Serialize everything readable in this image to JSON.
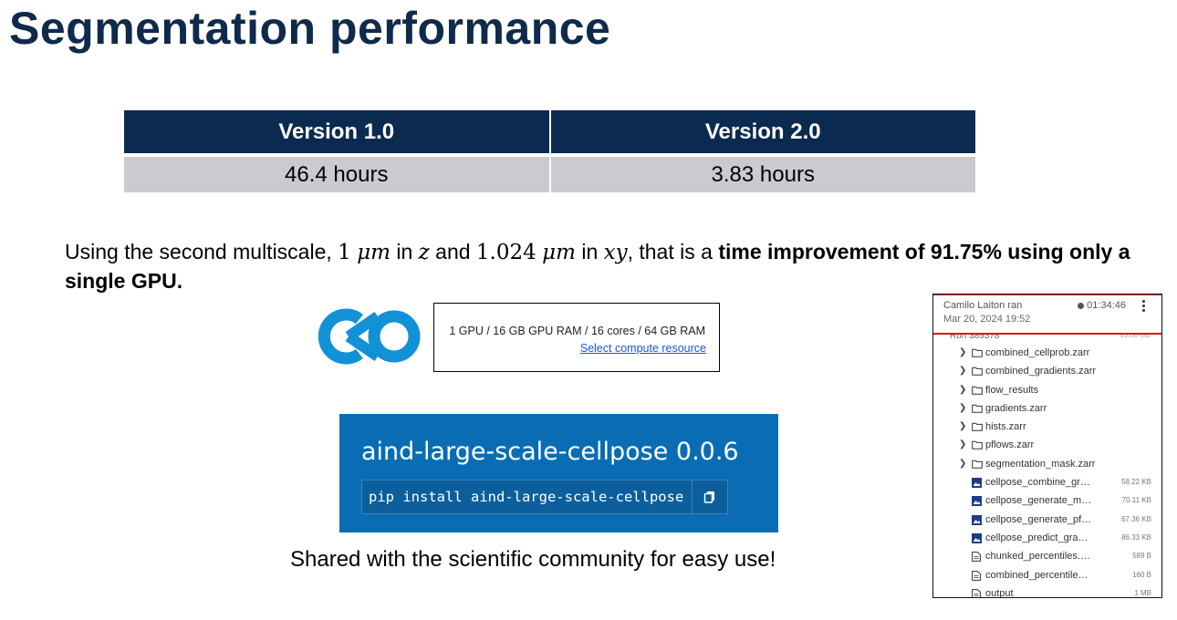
{
  "slide": {
    "title": "Segmentation performance"
  },
  "comparison_table": {
    "headers": [
      "Version 1.0",
      "Version 2.0"
    ],
    "values": [
      "46.4 hours",
      "3.83 hours"
    ]
  },
  "paragraph": {
    "p1": "Using the second multiscale, ",
    "v1": "1",
    "u1": "μm",
    "p2": " in ",
    "ax1": "z",
    "p3": " and ",
    "v2": "1.024",
    "u2": "μm",
    "p4": " in ",
    "ax2": "xy",
    "p5": ", that is a ",
    "bold": "time improvement of 91.75% using only a single GPU."
  },
  "compute": {
    "spec": "1 GPU / 16 GB GPU RAM / 16 cores / 64 GB RAM",
    "link": "Select compute resource"
  },
  "pypi": {
    "package": "aind-large-scale-cellpose 0.0.6",
    "command": "pip install aind-large-scale-cellpose"
  },
  "caption": "Shared with the scientific community for easy use!",
  "file_panel": {
    "run_user": "Camilo Laiton ran",
    "run_date": "Mar 20, 2024 19:52",
    "run_duration": "01:34:46",
    "run_row": "Run 389378",
    "run_size": "15.00 GB",
    "items": [
      {
        "type": "folder",
        "name": "combined_cellprob.zarr"
      },
      {
        "type": "folder",
        "name": "combined_gradients.zarr"
      },
      {
        "type": "folder",
        "name": "flow_results"
      },
      {
        "type": "folder",
        "name": "gradients.zarr"
      },
      {
        "type": "folder",
        "name": "hists.zarr"
      },
      {
        "type": "folder",
        "name": "pflows.zarr"
      },
      {
        "type": "folder",
        "name": "segmentation_mask.zarr"
      },
      {
        "type": "image",
        "name": "cellpose_combine_gradi...",
        "size": "58.22 KB"
      },
      {
        "type": "image",
        "name": "cellpose_generate_masks...",
        "size": "70.11 KB"
      },
      {
        "type": "image",
        "name": "cellpose_generate_pflow...",
        "size": "67.36 KB"
      },
      {
        "type": "image",
        "name": "cellpose_predict_gradie...",
        "size": "86.33 KB"
      },
      {
        "type": "file",
        "name": "chunked_percentiles.npy",
        "size": "589 B"
      },
      {
        "type": "file",
        "name": "combined_percentiles.npy",
        "size": "160 B"
      },
      {
        "type": "file",
        "name": "output",
        "size": "1 MB"
      }
    ]
  },
  "colors": {
    "title": "#0f2a4a",
    "table_header": "#0b2a4f",
    "table_cell": "#c9cbce",
    "logo": "#1191d6",
    "pypi_bg": "#0a6db3",
    "highlight_box": "#e01616"
  },
  "icons": [
    "codeocean-logo",
    "copy-icon",
    "kebab-menu-icon",
    "chevron-right-icon",
    "folder-icon",
    "image-file-icon",
    "file-icon"
  ]
}
